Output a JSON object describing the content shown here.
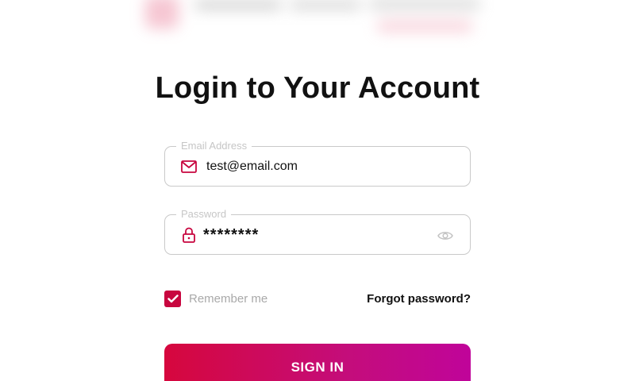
{
  "header": {
    "title": "Login to Your Account"
  },
  "form": {
    "email": {
      "label": "Email Address",
      "value": "test@email.com",
      "icon": "mail-icon"
    },
    "password": {
      "label": "Password",
      "value": "********",
      "icon": "lock-icon",
      "toggle_icon": "eye-icon"
    },
    "remember": {
      "label": "Remember me",
      "checked": true
    },
    "forgot_label": "Forgot password?",
    "signin_label": "SIGN IN"
  },
  "colors": {
    "accent": "#c8063f",
    "gradient_start": "#d6073d",
    "gradient_end": "#c0049a",
    "border": "#c9c9c9",
    "label": "#c6c6c6"
  }
}
